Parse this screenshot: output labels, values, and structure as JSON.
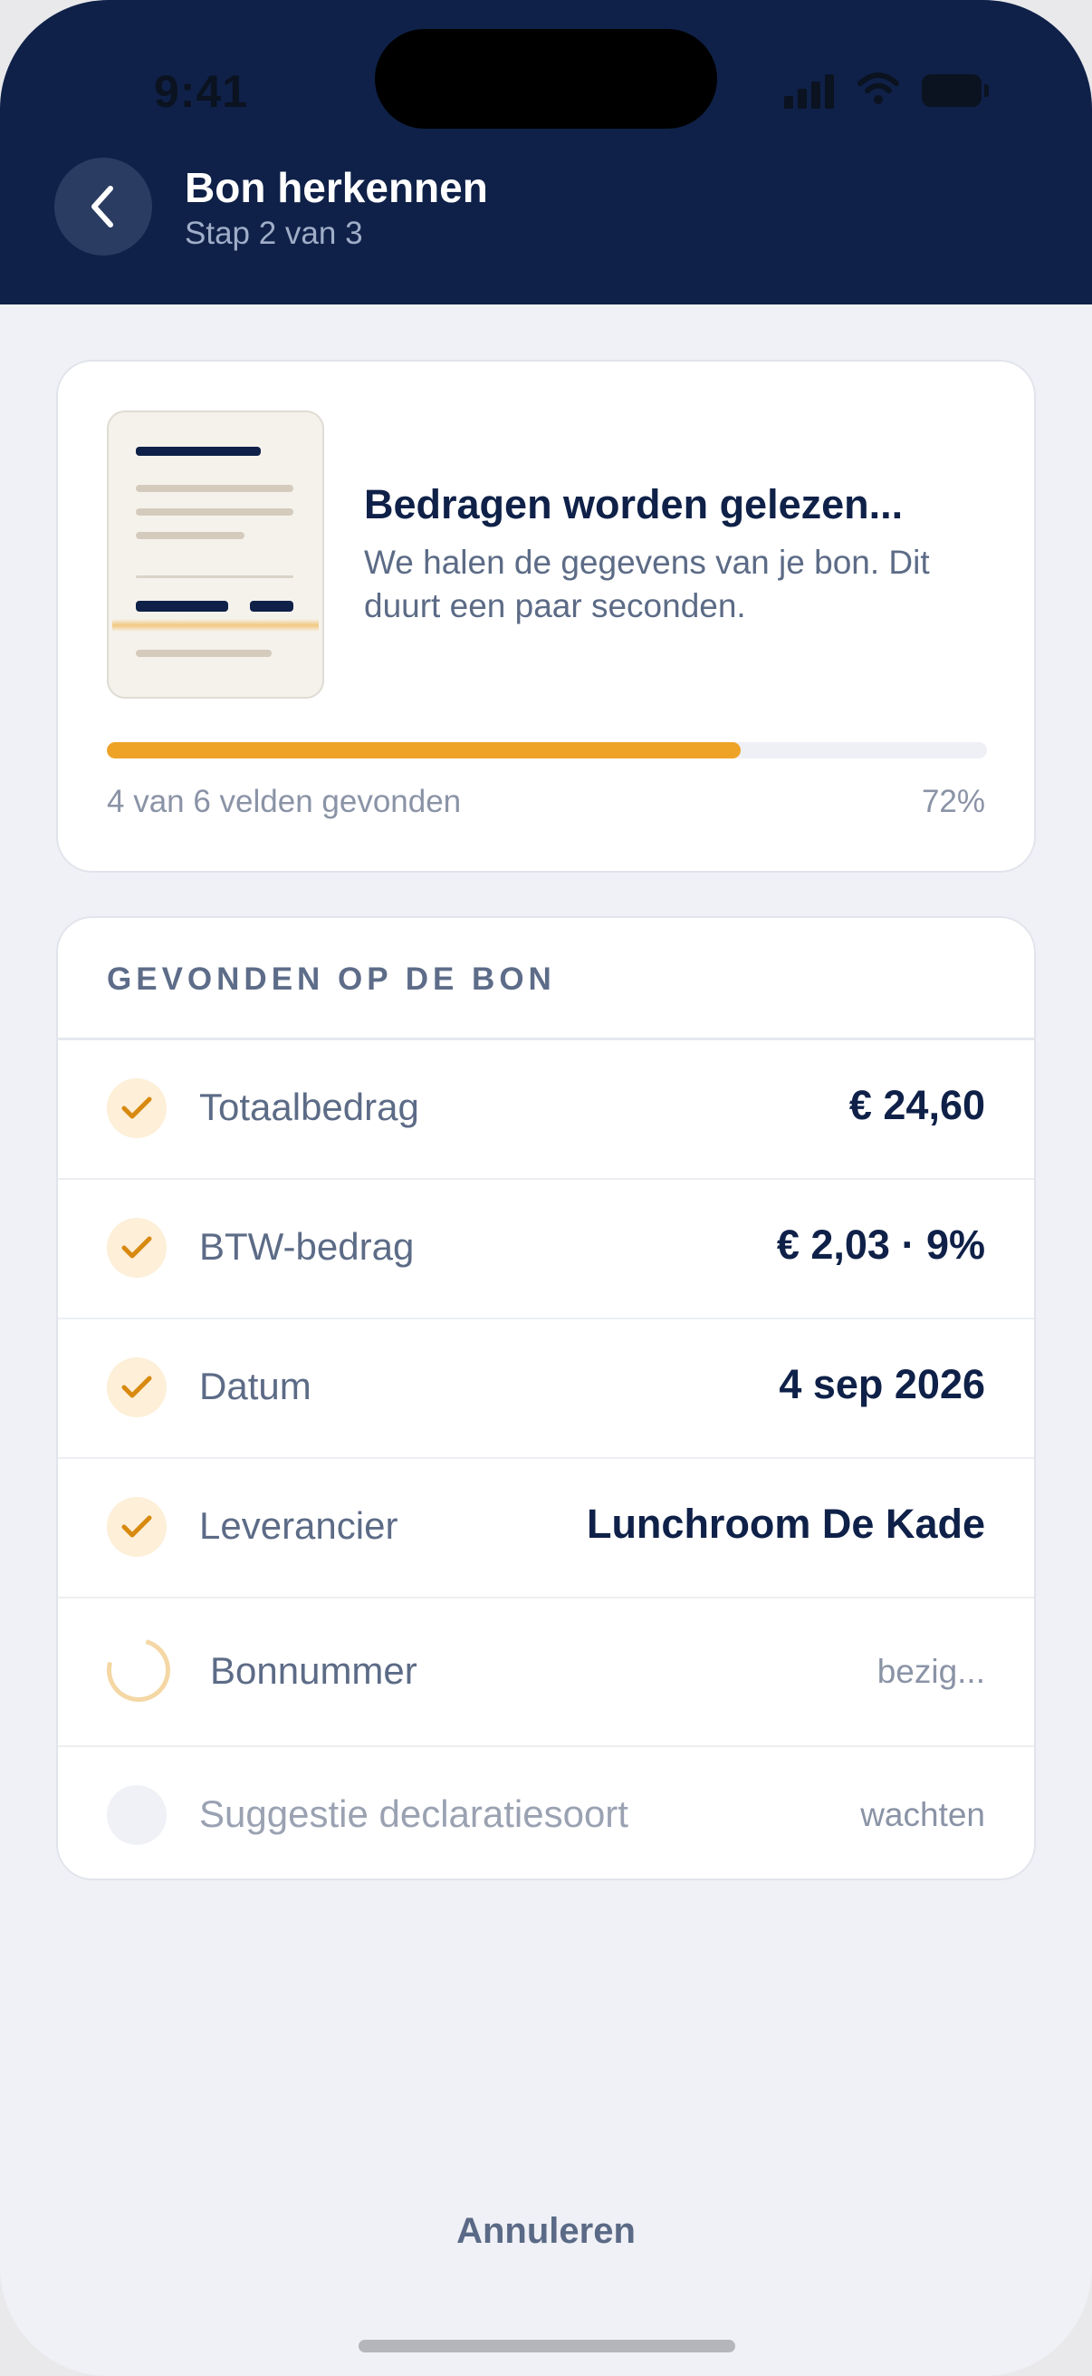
{
  "status_bar": {
    "time": "9:41"
  },
  "header": {
    "title": "Bon herkennen",
    "subtitle": "Stap 2 van 3",
    "back_icon": "chevron-left-icon"
  },
  "progress_card": {
    "heading": "Bedragen worden gelezen...",
    "description": "We halen de gegevens van je bon. Dit duurt een paar seconden.",
    "progress_fraction": 0.72,
    "found_text": "4 van 6 velden gevonden",
    "percent_text": "72%"
  },
  "found_section": {
    "title": "GEVONDEN OP DE BON",
    "rows": [
      {
        "label": "Totaalbedrag",
        "value": "€ 24,60",
        "state": "done"
      },
      {
        "label": "BTW-bedrag",
        "value": "€ 2,03 · 9%",
        "state": "done"
      },
      {
        "label": "Datum",
        "value": "4 sep 2026",
        "state": "done"
      },
      {
        "label": "Leverancier",
        "value": "Lunchroom De Kade",
        "state": "done"
      },
      {
        "label": "Bonnummer",
        "value": "bezig...",
        "state": "loading"
      },
      {
        "label": "Suggestie declaratiesoort",
        "value": "wachten",
        "state": "pending"
      }
    ]
  },
  "footer": {
    "cancel_label": "Annuleren"
  },
  "colors": {
    "header_bg": "#0f2148",
    "accent": "#eea327",
    "page_bg": "#f0f1f6",
    "text_primary": "#0f2148",
    "text_secondary": "#5c6b86"
  }
}
